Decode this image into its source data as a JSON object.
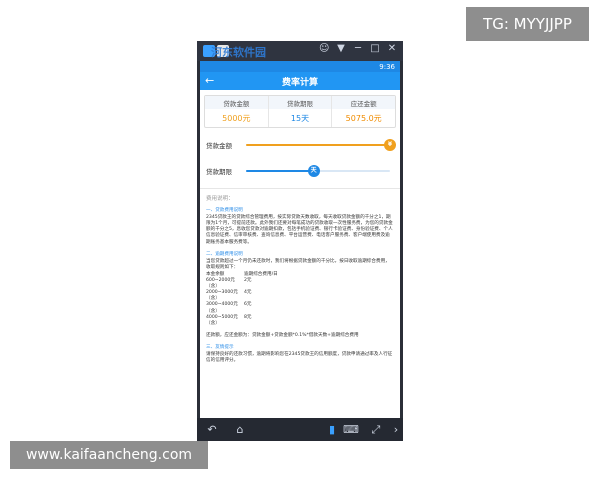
{
  "overlay": {
    "tg_badge": "TG: MYYJJPP",
    "site_badge": "www.kaifaancheng.com"
  },
  "emulator": {
    "toolbar_watermark": "河东软件园",
    "toolbar_icons": [
      "person-icon",
      "dropdown-icon",
      "minimize-icon",
      "maximize-icon",
      "close-icon"
    ]
  },
  "statusbar": {
    "time": "9:36"
  },
  "appbar": {
    "title": "费率计算",
    "back_icon": "←"
  },
  "summary": {
    "cols": [
      {
        "head": "贷款金额",
        "value": "5000元"
      },
      {
        "head": "贷款期限",
        "value": "15天"
      },
      {
        "head": "应还金额",
        "value": "5075.0元"
      }
    ]
  },
  "sliders": {
    "amount": {
      "label": "贷款金额",
      "thumb": "¥",
      "fraction": 1.0,
      "color": "#f0a01e"
    },
    "term": {
      "label": "贷款期限",
      "thumb": "天",
      "fraction": 0.47,
      "color": "#1e88e5"
    }
  },
  "description": {
    "heading": "费用说明：",
    "sec1_title": "一、贷款费用说明",
    "sec1_text": "2345贷款王的贷款综合管理费用，按实际贷款天数收取，每天收取贷款金额的千分之1，期限为1个月，可提前还款。此外我们还要对每笔成功的贷款收取一次性服务费，为您的贷款金额的千分之5，息收您贷款对逾期扣款，包括手机验证费、银行卡验证费、身份验证费、个人信息验证费、信审审核费、查询信息费、平台运营费、电话客户服务费、客户端使用费及逾期账务基本服务费等。",
    "sec2_title": "二、逾期费用说明",
    "sec2_text": "当您贷款超过一个月仍未还款时，我们将根据贷款金额的千分比，按日收取逾期综合费用，收取规则如下：",
    "fee_table": {
      "header": [
        "本金余额",
        "逾期综合费用/日"
      ],
      "rows": [
        [
          "600~2000元（含）",
          "2元"
        ],
        [
          "2000~3000元（含）",
          "4元"
        ],
        [
          "3000~4000元（含）",
          "6元"
        ],
        [
          "4000~5000元（含）",
          "8元"
        ]
      ]
    },
    "formula": "还款额，应还金额为：贷款金额+贷款金额*0.1%*借款天数+逾期综合费用",
    "sec3_title": "三、友情提示",
    "sec3_text": "请保持良好的还款习惯，逾期将影响您在2345贷款王的信用额度，贷款申请通过率及人行征信的信用评分。"
  },
  "navbar": {
    "buttons": [
      "back-icon",
      "home-icon",
      "recent-apps-icon",
      "keyboard-icon",
      "fullscreen-icon",
      "more-icon"
    ]
  }
}
